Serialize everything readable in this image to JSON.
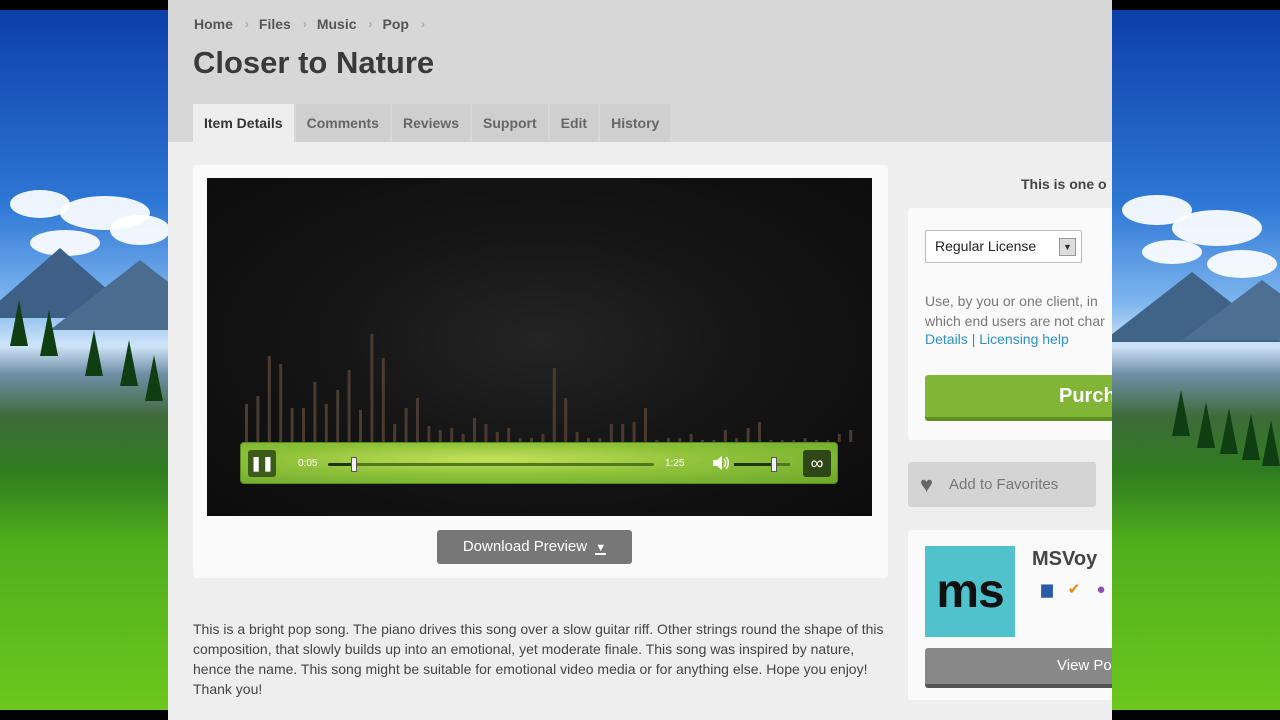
{
  "breadcrumb": [
    "Home",
    "Files",
    "Music",
    "Pop"
  ],
  "breadcrumb_separator": "›",
  "title": "Closer to Nature",
  "tabs": [
    "Item Details",
    "Comments",
    "Reviews",
    "Support",
    "Edit",
    "History"
  ],
  "active_tab": "Item Details",
  "player": {
    "current_time": "0:05",
    "total_time": "1:25",
    "seek_progress": 0.08,
    "volume_level": 0.72,
    "pause_icon": "pause-icon",
    "loop_icon": "loop-icon",
    "accent_color": "#8fc23a",
    "waveform_bar_color": "#4a3a30"
  },
  "download_button": "Download Preview",
  "description": "This is a bright pop song. The piano drives this song over a slow guitar riff. Other strings round the shape of this composition, that slowly builds up into an emotional, yet moderate finale. This song was inspired by nature, hence the name. This song might be suitable for emotional video media or for anything else. Hope you enjoy! Thank you!",
  "sidebar": {
    "exclusive_note": "This is one o",
    "license_select": "Regular License",
    "license_desc_line1": "Use, by you or one client, in",
    "license_desc_line2": "which end users are not char",
    "details_link": "Details",
    "link_separator": "|",
    "licensing_help_link": "Licensing help",
    "purchase_button": "Purch",
    "purchase_color": "#80b536",
    "favorites_button": "Add to Favorites",
    "author": {
      "avatar_text": "ms",
      "name": "MSVoy",
      "badges": [
        "flag-badge-icon",
        "check-badge-icon",
        "award-badge-icon"
      ],
      "view_portfolio_button": "View Po"
    }
  }
}
